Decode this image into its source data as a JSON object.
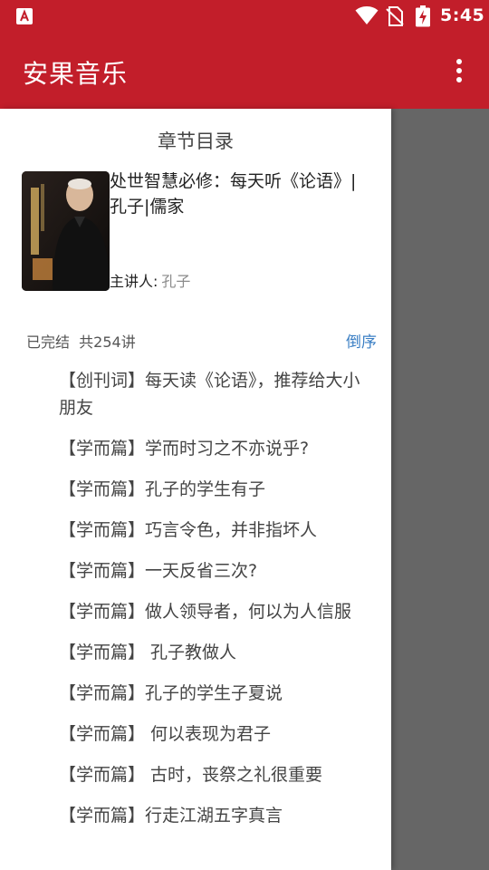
{
  "status_bar": {
    "time": "5:45",
    "icons": [
      "app-notification-icon",
      "wifi-icon",
      "no-sim-icon",
      "battery-charging-icon"
    ]
  },
  "app_bar": {
    "title": "安果音乐",
    "menu_icon": "more-vertical-icon"
  },
  "drawer": {
    "title": "章节目录",
    "book_title": "处世智慧必修：每天听《论语》|孔子|儒家",
    "speaker_label": "主讲人:",
    "speaker_name": "孔子",
    "status_text": "已完结  共254讲",
    "sort_label": "倒序",
    "chapters": [
      "【创刊词】每天读《论语》，推荐给大小朋友",
      "【学而篇】学而时习之不亦说乎?",
      "【学而篇】孔子的学生有子",
      "【学而篇】巧言令色，并非指坏人",
      "【学而篇】一天反省三次?",
      "【学而篇】做人领导者，何以为人信服",
      "【学而篇】 孔子教做人",
      "【学而篇】孔子的学生子夏说",
      "【学而篇】 何以表现为君子",
      "【学而篇】 古时，丧祭之礼很重要",
      "【学而篇】行走江湖五字真言"
    ]
  },
  "colors": {
    "primary": "#c21e2a",
    "link": "#3b7fc4",
    "overlay": "#666666"
  }
}
